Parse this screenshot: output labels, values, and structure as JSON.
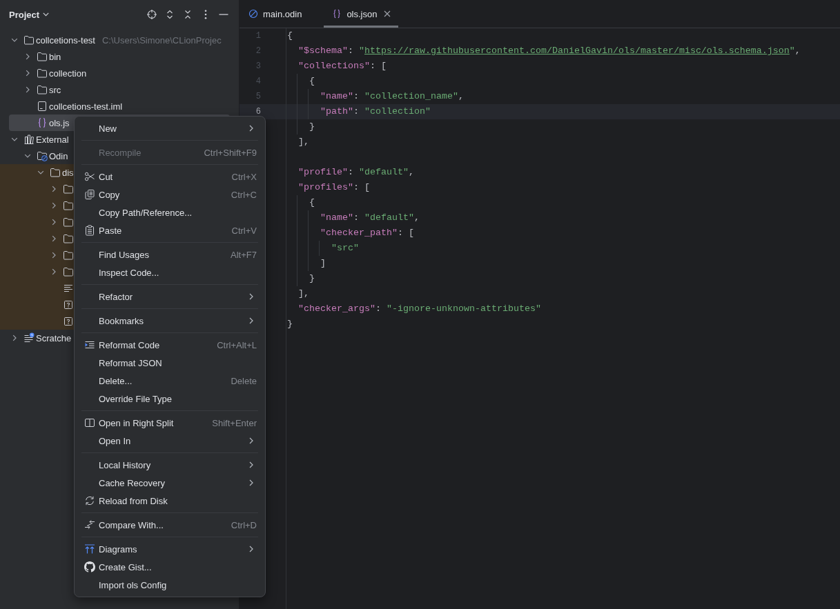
{
  "project_panel": {
    "title": "Project",
    "tree": [
      {
        "kind": "folder",
        "label": "collcetions-test",
        "hint": "C:\\Users\\Simone\\CLionProjec",
        "expanded": true,
        "selected": false,
        "highlighted": false,
        "children": [
          {
            "kind": "folder",
            "label": "bin",
            "expanded": false,
            "selected": false,
            "highlighted": false
          },
          {
            "kind": "folder",
            "label": "collection",
            "expanded": false,
            "selected": false,
            "highlighted": false
          },
          {
            "kind": "folder",
            "label": "src",
            "expanded": false,
            "selected": false,
            "highlighted": false
          },
          {
            "kind": "module",
            "label": "collcetions-test.iml",
            "selected": false,
            "highlighted": false
          },
          {
            "kind": "json",
            "label": "ols.js",
            "selected": true,
            "highlighted": false
          }
        ]
      },
      {
        "kind": "library",
        "label": "External",
        "expanded": true,
        "selected": false,
        "highlighted": false,
        "children": [
          {
            "kind": "sdk",
            "label": "Odin",
            "expanded": true,
            "selected": false,
            "highlighted": false,
            "children": [
              {
                "kind": "folder",
                "label": "dis",
                "expanded": true,
                "selected": false,
                "highlighted": true,
                "children": [
                  {
                    "kind": "folder",
                    "expanded": false,
                    "selected": false,
                    "highlighted": true
                  },
                  {
                    "kind": "folder",
                    "expanded": false,
                    "selected": false,
                    "highlighted": true
                  },
                  {
                    "kind": "folder",
                    "expanded": false,
                    "selected": false,
                    "highlighted": true
                  },
                  {
                    "kind": "folder",
                    "expanded": false,
                    "selected": false,
                    "highlighted": true
                  },
                  {
                    "kind": "folder",
                    "expanded": false,
                    "selected": false,
                    "highlighted": true
                  },
                  {
                    "kind": "folder",
                    "expanded": false,
                    "selected": false,
                    "highlighted": true
                  },
                  {
                    "kind": "text",
                    "selected": false,
                    "highlighted": true
                  },
                  {
                    "kind": "unknown",
                    "selected": false,
                    "highlighted": true
                  },
                  {
                    "kind": "unknown",
                    "selected": false,
                    "highlighted": true
                  }
                ]
              }
            ]
          }
        ]
      },
      {
        "kind": "scratches",
        "label": "Scratche",
        "expanded": false,
        "selected": false,
        "highlighted": false
      }
    ]
  },
  "editor": {
    "tabs": [
      {
        "kind": "odin",
        "label": "main.odin",
        "selected": false,
        "closable": false
      },
      {
        "kind": "json",
        "label": "ols.json",
        "selected": true,
        "closable": true
      }
    ],
    "lines": [
      {
        "number": "1",
        "current": false,
        "tokens": [
          {
            "kind": "punct",
            "text": "{"
          }
        ]
      },
      {
        "number": "2",
        "current": false,
        "tokens": [
          {
            "kind": "key",
            "text": "  \"$schema\""
          },
          {
            "kind": "punct",
            "text": ": "
          },
          {
            "kind": "string",
            "text": "\""
          },
          {
            "kind": "link",
            "text": "https://raw.githubusercontent.com/DanielGavin/ols/master/misc/ols.schema.json"
          },
          {
            "kind": "string",
            "text": "\""
          },
          {
            "kind": "punct",
            "text": ","
          }
        ]
      },
      {
        "number": "3",
        "current": false,
        "tokens": [
          {
            "kind": "key",
            "text": "  \"collections\""
          },
          {
            "kind": "punct",
            "text": ": ["
          }
        ]
      },
      {
        "number": "4",
        "current": false,
        "tokens": [
          {
            "kind": "punct",
            "text": "    {"
          }
        ]
      },
      {
        "number": "5",
        "current": false,
        "tokens": [
          {
            "kind": "key",
            "text": "      \"name\""
          },
          {
            "kind": "punct",
            "text": ": "
          },
          {
            "kind": "string",
            "text": "\"collection_name\""
          },
          {
            "kind": "punct",
            "text": ","
          }
        ]
      },
      {
        "number": "6",
        "current": true,
        "tokens": [
          {
            "kind": "key",
            "text": "      \"path\""
          },
          {
            "kind": "punct",
            "text": ": "
          },
          {
            "kind": "string",
            "text": "\"collection\""
          }
        ]
      },
      {
        "current": false,
        "tokens": [
          {
            "kind": "punct",
            "text": "    }"
          }
        ]
      },
      {
        "current": false,
        "tokens": [
          {
            "kind": "punct",
            "text": "  ],"
          }
        ]
      },
      {
        "current": false
      },
      {
        "current": false,
        "tokens": [
          {
            "kind": "key",
            "text": "  \"profile\""
          },
          {
            "kind": "punct",
            "text": ": "
          },
          {
            "kind": "string",
            "text": "\"default\""
          },
          {
            "kind": "punct",
            "text": ","
          }
        ]
      },
      {
        "current": false,
        "tokens": [
          {
            "kind": "key",
            "text": "  \"profiles\""
          },
          {
            "kind": "punct",
            "text": ": ["
          }
        ]
      },
      {
        "current": false,
        "tokens": [
          {
            "kind": "punct",
            "text": "    {"
          }
        ]
      },
      {
        "current": false,
        "tokens": [
          {
            "kind": "key",
            "text": "      \"name\""
          },
          {
            "kind": "punct",
            "text": ": "
          },
          {
            "kind": "string",
            "text": "\"default\""
          },
          {
            "kind": "punct",
            "text": ","
          }
        ]
      },
      {
        "current": false,
        "tokens": [
          {
            "kind": "key",
            "text": "      \"checker_path\""
          },
          {
            "kind": "punct",
            "text": ": ["
          }
        ]
      },
      {
        "current": false,
        "tokens": [
          {
            "kind": "string",
            "text": "        \"src\""
          }
        ]
      },
      {
        "current": false,
        "tokens": [
          {
            "kind": "punct",
            "text": "      ]"
          }
        ]
      },
      {
        "current": false,
        "tokens": [
          {
            "kind": "punct",
            "text": "    }"
          }
        ]
      },
      {
        "current": false,
        "tokens": [
          {
            "kind": "punct",
            "text": "  ],"
          }
        ]
      },
      {
        "current": false,
        "tokens": [
          {
            "kind": "key",
            "text": "  \"checker_args\""
          },
          {
            "kind": "punct",
            "text": ": "
          },
          {
            "kind": "string",
            "text": "\"-ignore-unknown-attributes\""
          }
        ]
      },
      {
        "current": false,
        "tokens": [
          {
            "kind": "punct",
            "text": "}"
          }
        ]
      }
    ]
  },
  "context_menu": {
    "groups": [
      [
        {
          "kind": "plain",
          "label": "New",
          "has_submenu": true,
          "disabled": false
        }
      ],
      [
        {
          "kind": "plain",
          "label": "Recompile",
          "shortcut": "Ctrl+Shift+F9",
          "has_submenu": false,
          "disabled": true
        }
      ],
      [
        {
          "kind": "cut",
          "label": "Cut",
          "shortcut": "Ctrl+X",
          "has_submenu": false,
          "disabled": false
        },
        {
          "kind": "copy",
          "label": "Copy",
          "shortcut": "Ctrl+C",
          "has_submenu": false,
          "disabled": false
        },
        {
          "kind": "plain",
          "label": "Copy Path/Reference...",
          "has_submenu": false,
          "disabled": false
        },
        {
          "kind": "paste",
          "label": "Paste",
          "shortcut": "Ctrl+V",
          "has_submenu": false,
          "disabled": false
        }
      ],
      [
        {
          "kind": "plain",
          "label": "Find Usages",
          "shortcut": "Alt+F7",
          "has_submenu": false,
          "disabled": false
        },
        {
          "kind": "plain",
          "label": "Inspect Code...",
          "has_submenu": false,
          "disabled": false
        }
      ],
      [
        {
          "kind": "plain",
          "label": "Refactor",
          "has_submenu": true,
          "disabled": false
        }
      ],
      [
        {
          "kind": "plain",
          "label": "Bookmarks",
          "has_submenu": true,
          "disabled": false
        }
      ],
      [
        {
          "kind": "reformat",
          "label": "Reformat Code",
          "shortcut": "Ctrl+Alt+L",
          "has_submenu": false,
          "disabled": false
        },
        {
          "kind": "plain",
          "label": "Reformat JSON",
          "has_submenu": false,
          "disabled": false
        },
        {
          "kind": "plain",
          "label": "Delete...",
          "shortcut": "Delete",
          "has_submenu": false,
          "disabled": false
        },
        {
          "kind": "plain",
          "label": "Override File Type",
          "has_submenu": false,
          "disabled": false
        }
      ],
      [
        {
          "kind": "split",
          "label": "Open in Right Split",
          "shortcut": "Shift+Enter",
          "has_submenu": false,
          "disabled": false
        },
        {
          "kind": "plain",
          "label": "Open In",
          "has_submenu": true,
          "disabled": false
        }
      ],
      [
        {
          "kind": "plain",
          "label": "Local History",
          "has_submenu": true,
          "disabled": false
        },
        {
          "kind": "plain",
          "label": "Cache Recovery",
          "has_submenu": true,
          "disabled": false
        },
        {
          "kind": "reload",
          "label": "Reload from Disk",
          "has_submenu": false,
          "disabled": false
        }
      ],
      [
        {
          "kind": "compare",
          "label": "Compare With...",
          "shortcut": "Ctrl+D",
          "has_submenu": false,
          "disabled": false
        }
      ],
      [
        {
          "kind": "diagrams",
          "label": "Diagrams",
          "has_submenu": true,
          "disabled": false
        },
        {
          "kind": "gist",
          "label": "Create Gist...",
          "has_submenu": false,
          "disabled": false
        },
        {
          "kind": "plain",
          "label": "Import ols Config",
          "has_submenu": false,
          "disabled": false
        }
      ]
    ]
  }
}
